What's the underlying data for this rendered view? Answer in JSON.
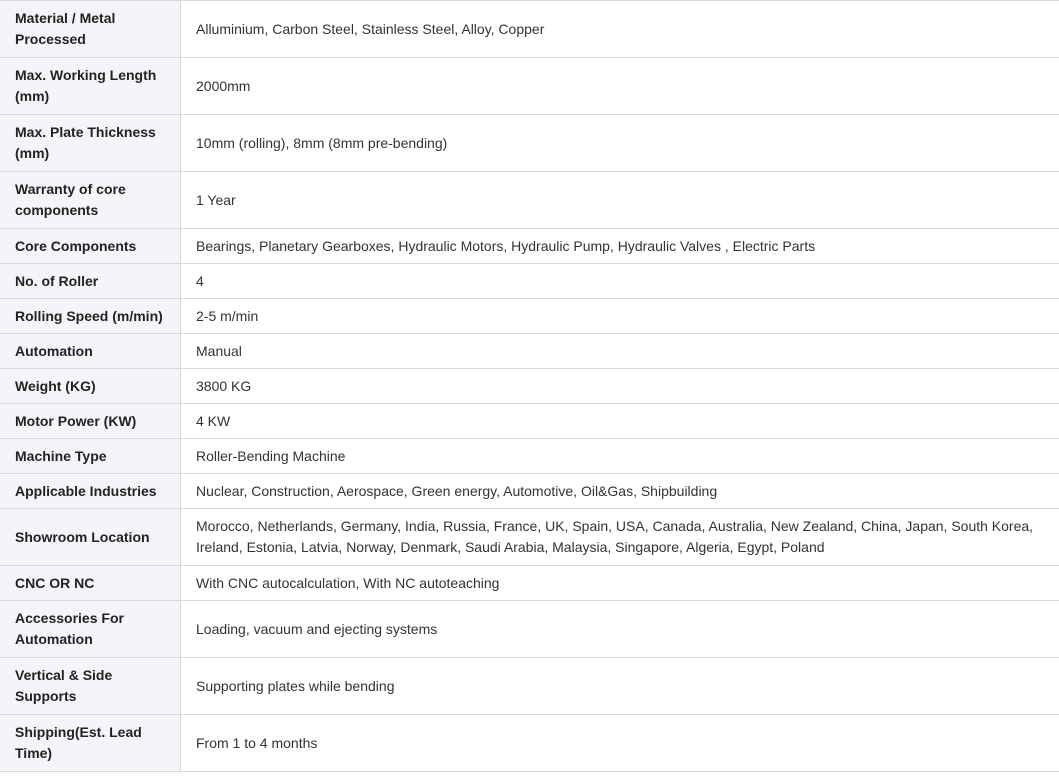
{
  "specs": [
    {
      "label": "Material / Metal Processed",
      "value": "Alluminium, Carbon Steel, Stainless Steel, Alloy, Copper"
    },
    {
      "label": "Max. Working Length (mm)",
      "value": "2000mm"
    },
    {
      "label": "Max. Plate Thickness (mm)",
      "value": "10mm (rolling), 8mm (8mm pre-bending)"
    },
    {
      "label": "Warranty of core components",
      "value": "1 Year"
    },
    {
      "label": "Core Components",
      "value": "Bearings, Planetary Gearboxes, Hydraulic Motors, Hydraulic Pump, Hydraulic Valves , Electric Parts"
    },
    {
      "label": "No. of Roller",
      "value": "4"
    },
    {
      "label": "Rolling Speed (m/min)",
      "value": "2-5 m/min"
    },
    {
      "label": "Automation",
      "value": "Manual"
    },
    {
      "label": "Weight (KG)",
      "value": "3800 KG"
    },
    {
      "label": "Motor Power (KW)",
      "value": "4 KW"
    },
    {
      "label": "Machine Type",
      "value": "Roller-Bending Machine"
    },
    {
      "label": "Applicable Industries",
      "value": "Nuclear, Construction, Aerospace, Green energy, Automotive, Oil&Gas, Shipbuilding"
    },
    {
      "label": "Showroom Location",
      "value": "Morocco, Netherlands, Germany, India, Russia, France, UK, Spain, USA, Canada, Australia, New Zealand, China, Japan, South Korea, Ireland, Estonia, Latvia, Norway, Denmark, Saudi Arabia, Malaysia, Singapore, Algeria, Egypt, Poland"
    },
    {
      "label": "CNC OR NC",
      "value": "With CNC autocalculation, With NC autoteaching"
    },
    {
      "label": "Accessories For Automation",
      "value": "Loading, vacuum and ejecting systems"
    },
    {
      "label": "Vertical & Side Supports",
      "value": "Supporting plates while bending"
    },
    {
      "label": "Shipping(Est. Lead Time)",
      "value": "From 1 to 4 months"
    }
  ]
}
